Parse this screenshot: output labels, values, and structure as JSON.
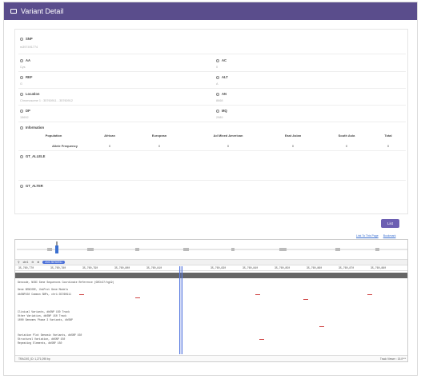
{
  "header": {
    "title": "Variant Detail"
  },
  "fields": {
    "snp": {
      "label": "SNP",
      "value": "rs397491774"
    },
    "aa": {
      "label": "AA",
      "value": "Cys"
    },
    "ac": {
      "label": "AC",
      "value": "0"
    },
    "ref": {
      "label": "REF",
      "value": "G"
    },
    "alt": {
      "label": "ALT",
      "value": "A"
    },
    "location": {
      "label": "Location",
      "value": "Chromosome 1 : 35760911 - 35760912"
    },
    "an": {
      "label": "AN",
      "value": "8668"
    },
    "dp": {
      "label": "DP",
      "value": "15692"
    },
    "mq": {
      "label": "MQ",
      "value": "2989"
    },
    "information": {
      "label": "Information"
    },
    "gt_allele": {
      "label": "GT_ALLELE"
    },
    "gt_alter": {
      "label": "GT_ALTER"
    }
  },
  "info_table": {
    "headers": [
      "Population",
      "African",
      "European",
      "Ad Mixed American",
      "East Asian",
      "South Asia",
      "Total"
    ],
    "row": [
      "Allele Frequency",
      "0",
      "0",
      "0",
      "0",
      "0",
      "0"
    ]
  },
  "list_button": "List",
  "browser": {
    "links": [
      "Link To This Page",
      "Bookmark"
    ],
    "chrom_select": "chr1",
    "position_pill": "chr1:35760911",
    "ruler_ticks": [
      "35,760,770",
      "35,760,780",
      "35,760,790",
      "35,760,800",
      "35,760,810",
      "35,760,820",
      "35,760,830",
      "35,760,840",
      "35,760,850",
      "35,760,860",
      "35,760,870",
      "35,760,880"
    ],
    "tracks": [
      "Gencode, NCBI Gene Sequences Coordinate Reference (GRCh37/hg19)",
      "Gene GENCODE, UniProt Gene Models",
      "dbSNP150 Common SNPs, chr1:35760911",
      "Clinical Variants, dbSNP 150 Track",
      "Other Variation, dbSNP 150 Track",
      "1000 Genomes Phase 3 Variants, dbSNP",
      "Variation Plot Genomic Variants, dbSNP 150",
      "Structural Variation, dbSNP 150",
      "Repeating Elements, dbSNP 150"
    ],
    "status_left": "TRACKS_ID: 1,271,095 bp",
    "status_right": "Track Viewer : 15.0***"
  }
}
